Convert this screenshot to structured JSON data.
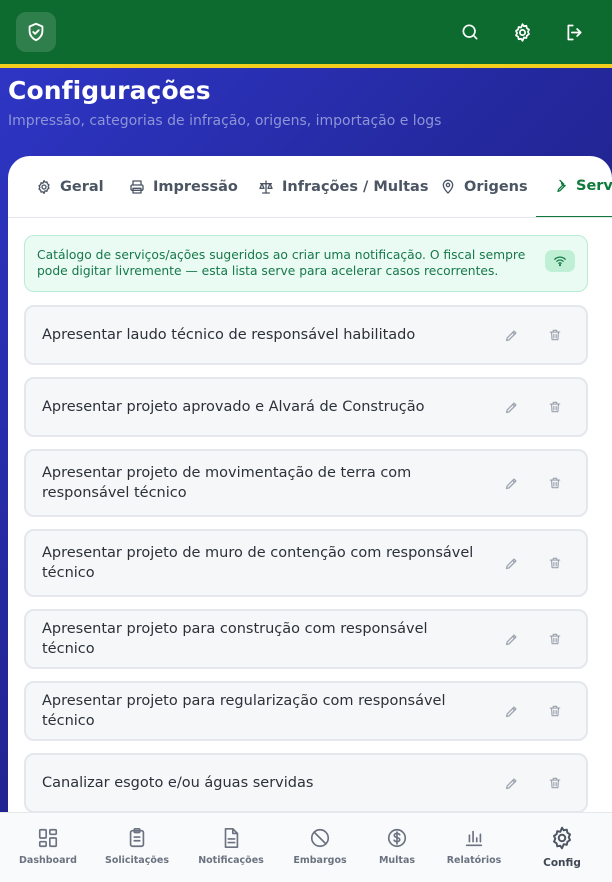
{
  "header": {
    "title": "Configurações",
    "subtitle": "Impressão, categorias de infração, origens, importação e logs",
    "icons": [
      "shield-check-icon",
      "search-icon",
      "gear-icon",
      "logout-icon"
    ]
  },
  "tabs": [
    {
      "label": "Geral",
      "icon": "gear-icon"
    },
    {
      "label": "Impressão",
      "icon": "printer-icon"
    },
    {
      "label": "Infrações / Multas",
      "icon": "scale-icon"
    },
    {
      "label": "Origens",
      "icon": "map-pin-icon"
    },
    {
      "label": "Serv",
      "icon": "wrench-icon",
      "active": true
    }
  ],
  "info": {
    "text": "Catálogo de serviços/ações sugeridos ao criar uma notificação. O fiscal sempre pode digitar livremente — esta lista serve para acelerar casos recorrentes.",
    "icon": "wifi-icon"
  },
  "items": [
    "Apresentar laudo técnico de responsável habilitado",
    "Apresentar projeto aprovado e Alvará de Construção",
    "Apresentar projeto de movimentação de terra com responsável técnico",
    "Apresentar projeto de muro de contenção com responsável técnico",
    "Apresentar projeto para construção com responsável técnico",
    "Apresentar projeto para regularização com responsável técnico",
    "Canalizar esgoto e/ou águas servidas"
  ],
  "nav": [
    {
      "label": "Dashboard",
      "icon": "dashboard-icon"
    },
    {
      "label": "Solicitações",
      "icon": "clipboard-icon"
    },
    {
      "label": "Notificações",
      "icon": "document-icon"
    },
    {
      "label": "Embargos",
      "icon": "ban-icon"
    },
    {
      "label": "Multas",
      "icon": "dollar-icon"
    },
    {
      "label": "Relatórios",
      "icon": "bar-chart-icon"
    },
    {
      "label": "Config",
      "icon": "gear-icon",
      "active": true
    }
  ],
  "colors": {
    "brand_green": "#0d6b2f",
    "accent_yellow": "#f2cf1c",
    "active_tab": "#0f7a3b",
    "background_blue": "#2f37c9"
  }
}
